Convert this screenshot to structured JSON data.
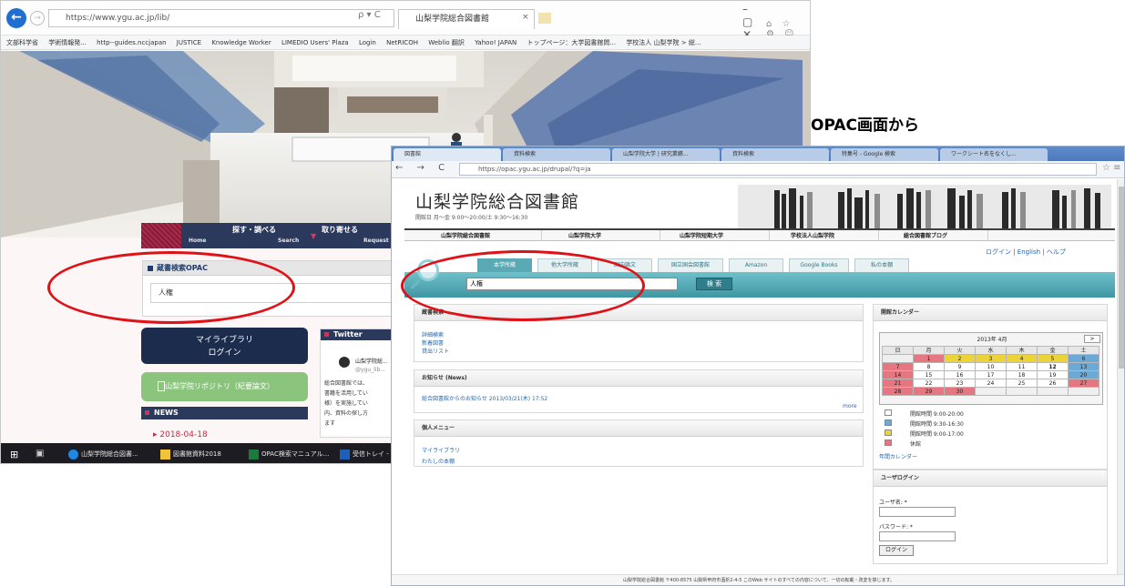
{
  "callout": "OPAC画面から",
  "ie": {
    "address": "https://www.ygu.ac.jp/lib/",
    "address_tools": "ρ ▾ C",
    "tab_title": "山梨学院総合図書館",
    "tab_close": "×",
    "win_buttons": "–  ▢  ✕",
    "right_icons": "⌂ ☆ ⚙ ☺",
    "favorites": [
      "文部科学省",
      "学術情報発...",
      "http--guides.nccjapan",
      "JUSTICE",
      "Knowledge Worker",
      "LIMEDIO Users' Plaza",
      "Login",
      "NetRICOH",
      "Weblio 翻訳",
      "Yahoo! JAPAN",
      "トップページ：大学図書館問...",
      "学校法人 山梨学院 > 総..."
    ]
  },
  "site": {
    "nav": [
      {
        "label": "探す・調べる",
        "sub": "Search"
      },
      {
        "label": "取り寄せる",
        "sub": "Request"
      }
    ],
    "nav_home": "Home",
    "opac_title": "蔵書検索OPAC",
    "opac_value": "人権",
    "mylib_line1": "マイライブラリ",
    "mylib_line2": "ログイン",
    "repository": "山梨学院リポジトリ（紀要論文）",
    "news_title": "NEWS",
    "news_date": "▸ 2018-04-18",
    "twitter_title": "Twitter",
    "tw_name": "山梨学院総...",
    "tw_handle": "@ygu_lib...",
    "tw_text": "総合図書館では、\n書籍を活用してい\n様）を実施してい\n内、資料の探し方\nます"
  },
  "taskbar": [
    {
      "label": "山梨学院総合図書...",
      "color": "#1e88e5"
    },
    {
      "label": "図書館資料2018",
      "color": "#f2c335"
    },
    {
      "label": "OPAC検索マニュアル...",
      "color": "#1e7a3c"
    },
    {
      "label": "受信トレイ - ...",
      "color": "#1e5fb8"
    }
  ],
  "chrome": {
    "tabs": [
      {
        "label": "図書館"
      },
      {
        "label": "資料検索"
      },
      {
        "label": "山梨学院大学 | 研究業績..."
      },
      {
        "label": "資料検索"
      },
      {
        "label": "特集号 - Google 検索"
      },
      {
        "label": "ワークシート名をなくし..."
      }
    ],
    "nav_buttons": "← → C ⌂",
    "url": "https://opac.ygu.ac.jp/drupal/?q=ja",
    "star": "☆ ≡"
  },
  "lib": {
    "title": "山梨学院総合図書館",
    "hours": "開館日 月～金 9:00～20:00/土 9:30～16:30",
    "nav": [
      "山梨学院総合図書館",
      "山梨学院大学",
      "山梨学院短期大学",
      "学校法人山梨学院",
      "総合図書館ブログ"
    ],
    "login_links": "ログイン | English | ヘルプ",
    "search_tabs": [
      "本学所蔵",
      "他大学所蔵",
      "国内論文",
      "国立国会図書館",
      "Amazon",
      "Google Books",
      "私の本棚"
    ],
    "search_value": "人権",
    "search_button": "検 索",
    "detail_title": "蔵書検索",
    "detail_links": [
      "詳細検索",
      "新着図書",
      "貸出リスト"
    ],
    "news_title": "お知らせ (News)",
    "news_item": "総合図書館からのお知らせ 2013/03/21(木) 17:52",
    "news_more": "more",
    "menu_title": "個人メニュー",
    "menu_links": [
      "マイライブラリ",
      "わたしの本棚"
    ],
    "cal_title": "開館カレンダー",
    "cal_month": "2013年 4月",
    "cal_next": ">",
    "cal_head": [
      "日",
      "月",
      "火",
      "水",
      "木",
      "金",
      "土"
    ],
    "cal_rows": [
      [
        "",
        "1",
        "2",
        "3",
        "4",
        "5",
        "6"
      ],
      [
        "7",
        "8",
        "9",
        "10",
        "11",
        "12",
        "13"
      ],
      [
        "14",
        "15",
        "16",
        "17",
        "18",
        "19",
        "20"
      ],
      [
        "21",
        "22",
        "23",
        "24",
        "25",
        "26",
        "27"
      ],
      [
        "28",
        "29",
        "30",
        "",
        "",
        "",
        ""
      ]
    ],
    "legend": [
      "開館時間 9:00-20:00",
      "開館時間 9:30-16:30",
      "開館時間 9:00-17:00",
      "休館"
    ],
    "legend_colors": [
      "#ffffff",
      "#6da9d6",
      "#ecd33a",
      "#e6767f"
    ],
    "year_cal": "年間カレンダー",
    "login_title": "ユーザログイン",
    "user_label": "ユーザ名: *",
    "pass_label": "パスワード: *",
    "login_button": "ログイン",
    "footer": "山梨学院総合図書館 〒400-8575 山梨県甲府市酒折2-4-5 このWeb サイトのすべての内容について、一切の転載・改変を禁じます。"
  }
}
